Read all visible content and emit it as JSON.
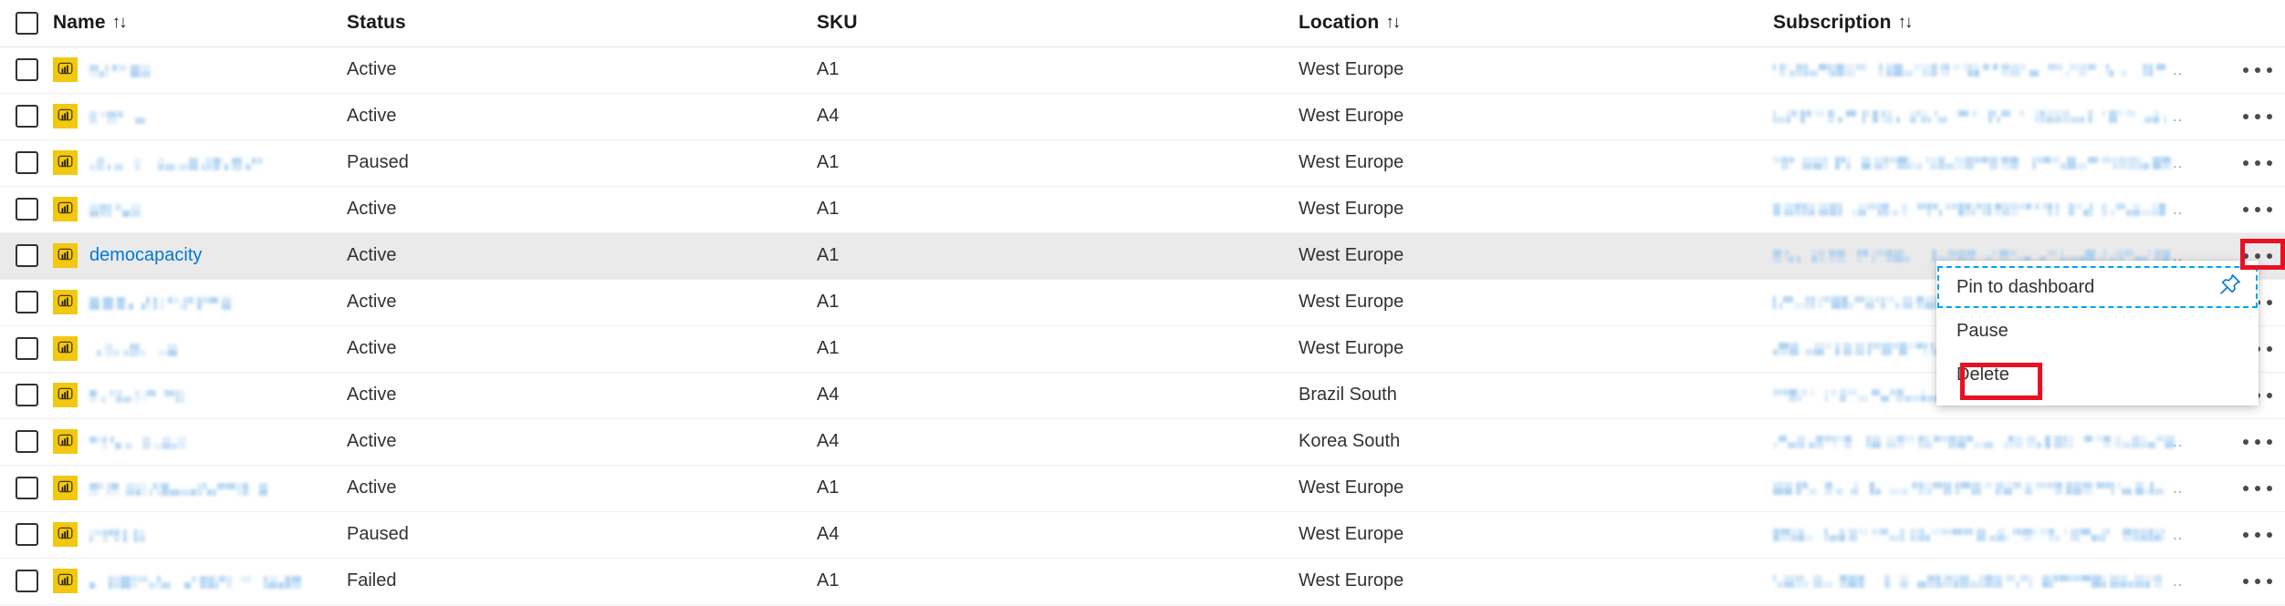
{
  "table": {
    "columns": [
      {
        "key": "name",
        "label": "Name",
        "sortable": true,
        "sort_glyph": "↑↓"
      },
      {
        "key": "status",
        "label": "Status",
        "sortable": false,
        "sort_glyph": ""
      },
      {
        "key": "sku",
        "label": "SKU",
        "sortable": false,
        "sort_glyph": ""
      },
      {
        "key": "location",
        "label": "Location",
        "sortable": true,
        "sort_glyph": "↑↓"
      },
      {
        "key": "subscription",
        "label": "Subscription",
        "sortable": true,
        "sort_glyph": "↑↓"
      }
    ],
    "select_all_checkbox": {
      "checked": false
    },
    "subscription_truncation_glyph": "..",
    "rows": [
      {
        "name": "",
        "redacted": true,
        "name_width": 62,
        "status": "Active",
        "sku": "A1",
        "location": "West Europe",
        "subscription": "",
        "sub_redacted": true,
        "hovered": false
      },
      {
        "name": "",
        "redacted": true,
        "name_width": 62,
        "status": "Active",
        "sku": "A4",
        "location": "West Europe",
        "subscription": "",
        "sub_redacted": true,
        "hovered": false
      },
      {
        "name": "",
        "redacted": true,
        "name_width": 186,
        "status": "Paused",
        "sku": "A1",
        "location": "West Europe",
        "subscription": "",
        "sub_redacted": true,
        "hovered": false
      },
      {
        "name": "",
        "redacted": true,
        "name_width": 57,
        "status": "Active",
        "sku": "A1",
        "location": "West Europe",
        "subscription": "",
        "sub_redacted": true,
        "hovered": false
      },
      {
        "name": "democapacity",
        "redacted": false,
        "name_width": 0,
        "status": "Active",
        "sku": "A1",
        "location": "West Europe",
        "subscription": "",
        "sub_redacted": true,
        "hovered": true
      },
      {
        "name": "",
        "redacted": true,
        "name_width": 158,
        "status": "Active",
        "sku": "A1",
        "location": "West Europe",
        "subscription": "",
        "sub_redacted": true,
        "hovered": false
      },
      {
        "name": "",
        "redacted": true,
        "name_width": 95,
        "status": "Active",
        "sku": "A1",
        "location": "West Europe",
        "subscription": "",
        "sub_redacted": true,
        "hovered": false
      },
      {
        "name": "",
        "redacted": true,
        "name_width": 108,
        "status": "Active",
        "sku": "A4",
        "location": "Brazil South",
        "subscription": "",
        "sub_redacted": true,
        "hovered": false
      },
      {
        "name": "",
        "redacted": true,
        "name_width": 105,
        "status": "Active",
        "sku": "A4",
        "location": "Korea South",
        "subscription": "",
        "sub_redacted": true,
        "hovered": false
      },
      {
        "name": "",
        "redacted": true,
        "name_width": 196,
        "status": "Active",
        "sku": "A1",
        "location": "West Europe",
        "subscription": "",
        "sub_redacted": true,
        "hovered": false
      },
      {
        "name": "",
        "redacted": true,
        "name_width": 56,
        "status": "Paused",
        "sku": "A4",
        "location": "West Europe",
        "subscription": "",
        "sub_redacted": true,
        "hovered": false
      },
      {
        "name": "",
        "redacted": true,
        "name_width": 228,
        "status": "Failed",
        "sku": "A1",
        "location": "West Europe",
        "subscription": "",
        "sub_redacted": true,
        "hovered": false
      }
    ]
  },
  "context_menu": {
    "open_for_row": "democapacity",
    "items": [
      {
        "label": "Pin to dashboard",
        "icon": "pin-icon",
        "focused": true,
        "highlighted": false
      },
      {
        "label": "Pause",
        "icon": "",
        "focused": false,
        "highlighted": false
      },
      {
        "label": "Delete",
        "icon": "",
        "focused": false,
        "highlighted": true
      }
    ]
  },
  "annotations": [
    {
      "name": "row-overflow-menu-highlight",
      "target": "ellipsis-button-democapacity",
      "color": "#e81123"
    },
    {
      "name": "delete-menu-item-highlight",
      "target": "menu-item-delete",
      "color": "#e81123"
    }
  ],
  "colors": {
    "link": "#0078d4",
    "pbi_icon_bg": "#F2C811",
    "row_hover_bg": "#ebeaea",
    "annotation_red": "#e81123",
    "focus_dashed": "#00a2f3",
    "redacted_blue": "#a5cdf0",
    "text": "#323130"
  }
}
